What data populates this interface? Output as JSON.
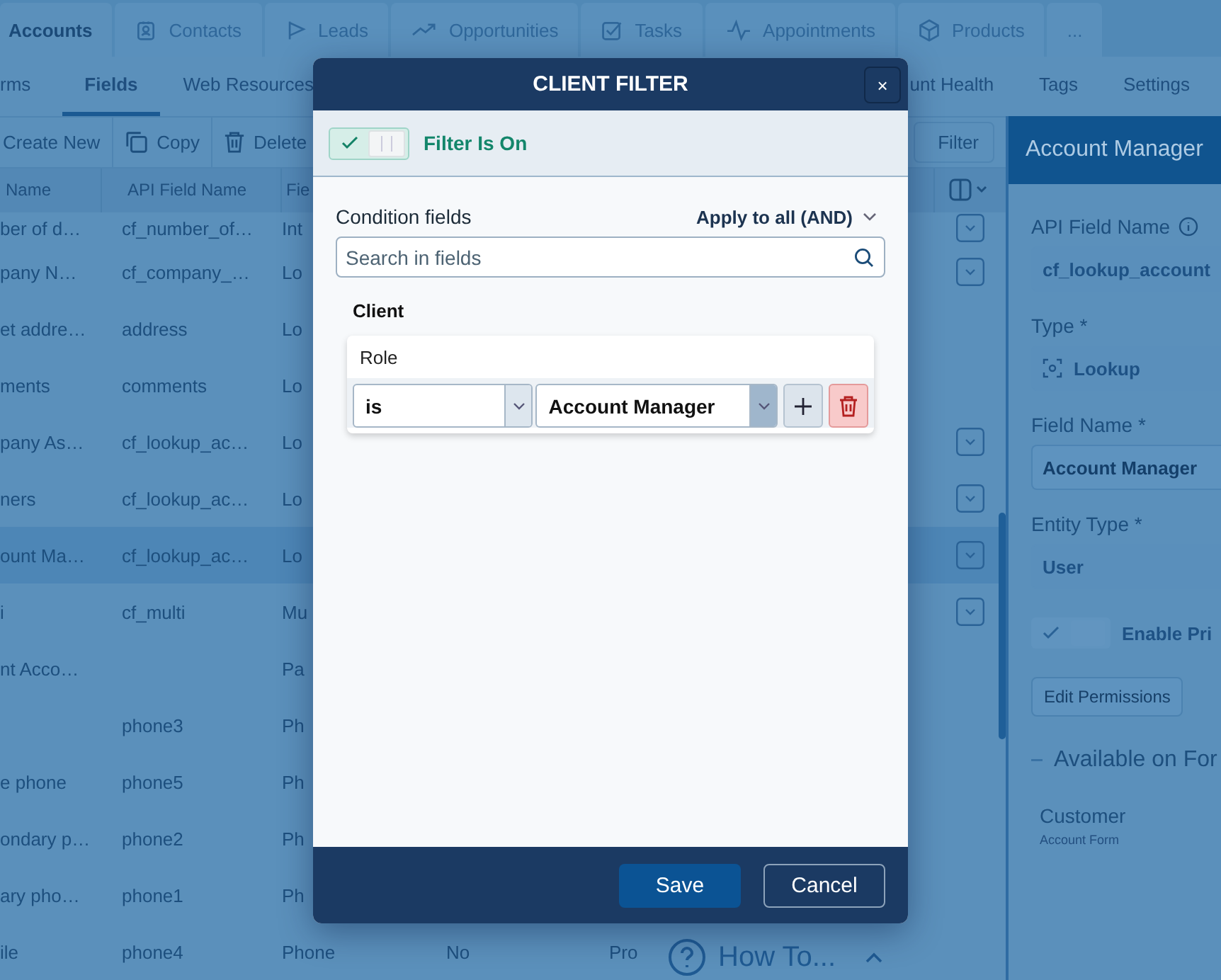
{
  "top_tabs": [
    {
      "label": "Accounts",
      "selected": true
    },
    {
      "label": "Contacts",
      "selected": false
    },
    {
      "label": "Leads",
      "selected": false
    },
    {
      "label": "Opportunities",
      "selected": false
    },
    {
      "label": "Tasks",
      "selected": false
    },
    {
      "label": "Appointments",
      "selected": false
    },
    {
      "label": "Products",
      "selected": false
    },
    {
      "label": "...",
      "selected": false
    }
  ],
  "sub_tabs": [
    {
      "label": "rms",
      "selected": false
    },
    {
      "label": "Fields",
      "selected": true
    },
    {
      "label": "Web Resources",
      "selected": false
    },
    {
      "label": "unt Health",
      "selected": false
    },
    {
      "label": "Tags",
      "selected": false
    },
    {
      "label": "Settings",
      "selected": false
    }
  ],
  "toolbar": {
    "buttons": [
      "Create New",
      "Copy",
      "Delete"
    ],
    "filter": "Filter"
  },
  "table": {
    "columns": [
      "Name",
      "API Field Name",
      "Fie"
    ],
    "rows": [
      {
        "cells": [
          "ber of d…",
          "cf_number_of…",
          "Int",
          "",
          ""
        ],
        "selected": false,
        "has_menu": true
      },
      {
        "cells": [
          "pany N…",
          "cf_company_…",
          "Lo",
          "",
          ""
        ],
        "selected": false,
        "has_menu": true
      },
      {
        "cells": [
          "et addre…",
          "address",
          "Lo",
          "",
          ""
        ],
        "selected": false,
        "has_menu": false
      },
      {
        "cells": [
          "ments",
          "comments",
          "Lo",
          "",
          ""
        ],
        "selected": false,
        "has_menu": false
      },
      {
        "cells": [
          "pany As…",
          "cf_lookup_ac…",
          "Lo",
          "",
          ""
        ],
        "selected": false,
        "has_menu": true
      },
      {
        "cells": [
          "ners",
          "cf_lookup_ac…",
          "Lo",
          "",
          ""
        ],
        "selected": false,
        "has_menu": true
      },
      {
        "cells": [
          "ount Ma…",
          "cf_lookup_ac…",
          "Lo",
          "",
          ""
        ],
        "selected": true,
        "has_menu": true
      },
      {
        "cells": [
          "i",
          "cf_multi",
          "Mu",
          "",
          ""
        ],
        "selected": false,
        "has_menu": true
      },
      {
        "cells": [
          "nt Acco…",
          "",
          "Pa",
          "",
          ""
        ],
        "selected": false,
        "has_menu": false
      },
      {
        "cells": [
          "",
          "phone3",
          "Ph",
          "",
          ""
        ],
        "selected": false,
        "has_menu": false
      },
      {
        "cells": [
          "e phone",
          "phone5",
          "Ph",
          "",
          ""
        ],
        "selected": false,
        "has_menu": false
      },
      {
        "cells": [
          "ondary p…",
          "phone2",
          "Ph",
          "",
          ""
        ],
        "selected": false,
        "has_menu": false
      },
      {
        "cells": [
          "ary pho…",
          "phone1",
          "Ph",
          "",
          ""
        ],
        "selected": false,
        "has_menu": false
      },
      {
        "cells": [
          "ile",
          "phone4",
          "Phone",
          "No",
          "Pro"
        ],
        "selected": false,
        "has_menu": false
      }
    ]
  },
  "help": {
    "label": "How To..."
  },
  "details": {
    "title": "Account Manager",
    "fields": [
      {
        "kind": "text",
        "label": "API Field Name",
        "info": true,
        "value": "cf_lookup_account",
        "disabled": true
      },
      {
        "kind": "select",
        "label": "Type *",
        "info": false,
        "value": "Lookup",
        "disabled": true
      },
      {
        "kind": "text",
        "label": "Field Name *",
        "info": false,
        "value": "Account Manager",
        "disabled": false
      },
      {
        "kind": "select",
        "label": "Entity Type *",
        "info": false,
        "value": "User",
        "disabled": true
      },
      {
        "kind": "toggle",
        "label": "Enable Pri",
        "on": true,
        "disabled": true
      },
      {
        "kind": "button",
        "label": "Edit Permissions"
      },
      {
        "kind": "section",
        "label": "Available on For"
      },
      {
        "kind": "form",
        "label": "Customer",
        "sub": "Account Form"
      }
    ]
  },
  "modal": {
    "title": "CLIENT FILTER",
    "close": "×",
    "filter_toggle": {
      "on": true,
      "label": "Filter Is On"
    },
    "condition_label": "Condition fields",
    "mode": "Apply to all (AND)",
    "search": {
      "placeholder": "Search in fields"
    },
    "group": "Client",
    "condition": {
      "field": "Role",
      "operator": "is",
      "value": "Account Manager"
    },
    "buttons": [
      "Save",
      "Cancel"
    ]
  }
}
